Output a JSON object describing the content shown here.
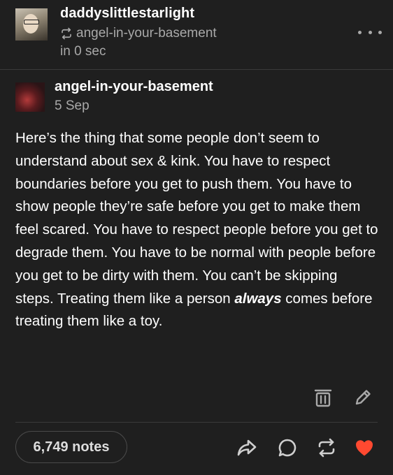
{
  "post": {
    "blog_name": "daddyslittlestarlight",
    "reblogged_from": "angel-in-your-basement",
    "timestamp": "in 0 sec",
    "more_icon": "more-dots-icon"
  },
  "trail": {
    "blog_name": "angel-in-your-basement",
    "date": "5 Sep",
    "body_before": "Here’s the thing that some people don’t seem to understand about sex & kink. You have to respect boundaries before you get to push them. You have to show people they’re safe before you get to make them feel scared. You have to respect people before you get to degrade them. You have to be normal with people before you get to be dirty with them. You can’t be skipping steps. Treating them like a person ",
    "body_emphasis": "always",
    "body_after": " comes before treating them like a toy."
  },
  "footer": {
    "notes": "6,749 notes",
    "icons": [
      "share-icon",
      "reply-icon",
      "reblog-icon",
      "like-icon"
    ],
    "like_color": "#ff4930"
  },
  "colors": {
    "background": "#1f1f1f",
    "text": "#ffffff",
    "muted": "#a9a9a9",
    "divider": "#3a3a3a"
  }
}
